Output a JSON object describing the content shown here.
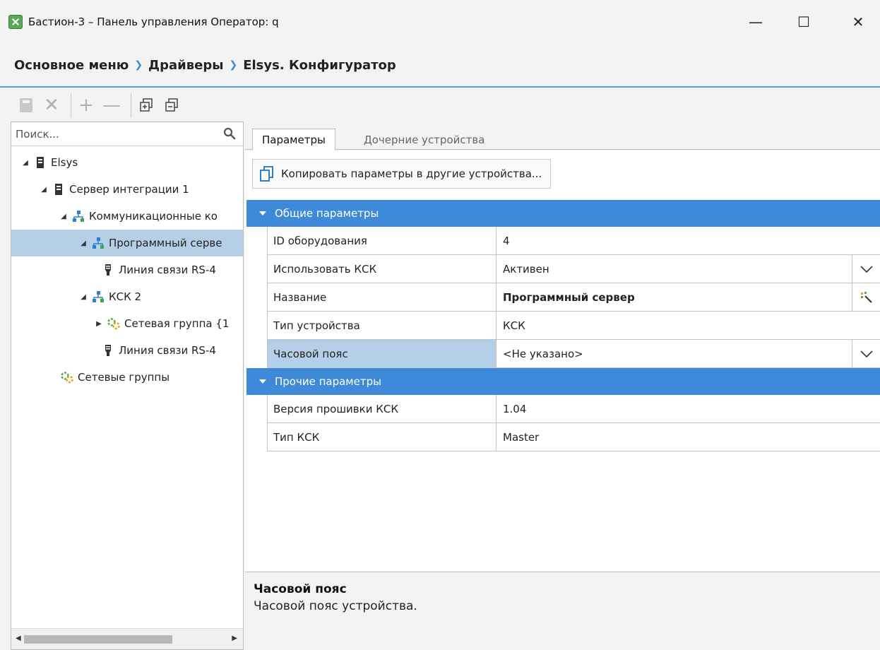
{
  "window": {
    "title": "Бастион-3 – Панель управления Оператор: q",
    "icon": "app-icon",
    "buttons": {
      "minimize": "—",
      "maximize": "☐",
      "close": "✕"
    }
  },
  "breadcrumb": {
    "items": [
      "Основное меню",
      "Драйверы",
      "Elsys. Конфигуратор"
    ],
    "separator": "❯"
  },
  "toolbar": {
    "icons": [
      "save-icon",
      "delete-icon",
      "add-icon",
      "remove-icon",
      "expand-all-icon",
      "collapse-all-icon"
    ],
    "delete_glyph": "✕",
    "add_glyph": "+",
    "remove_glyph": "—"
  },
  "search": {
    "placeholder": "Поиск..."
  },
  "tree": {
    "items": [
      {
        "label": "Elsys",
        "expander": "expanded",
        "icon": "server-icon"
      },
      {
        "label": "Сервер интеграции 1",
        "expander": "expanded",
        "icon": "server-icon"
      },
      {
        "label": "Коммуникационные ко",
        "expander": "expanded",
        "icon": "network-icon"
      },
      {
        "label": "Программный серве",
        "expander": "expanded",
        "icon": "network-icon",
        "selected": true
      },
      {
        "label": "Линия связи RS-4",
        "expander": "none",
        "icon": "line-icon"
      },
      {
        "label": "КСК 2",
        "expander": "expanded",
        "icon": "network-icon"
      },
      {
        "label": "Сетевая группа {1",
        "expander": "collapsed",
        "icon": "group-icon"
      },
      {
        "label": "Линия связи RS-4",
        "expander": "none",
        "icon": "line-icon"
      },
      {
        "label": "Сетевые группы",
        "expander": "none",
        "icon": "group-icon"
      }
    ]
  },
  "tabs": [
    {
      "label": "Параметры",
      "active": true
    },
    {
      "label": "Дочерние устройства",
      "active": false
    }
  ],
  "copy_button": {
    "label": "Копировать параметры в другие устройства..."
  },
  "groups": [
    {
      "title": "Общие параметры",
      "rows": [
        {
          "name": "ID оборудования",
          "value": "4"
        },
        {
          "name": "Использовать КСК",
          "value": "Активен",
          "control": "dropdown"
        },
        {
          "name": "Название",
          "value": "Программный сервер",
          "control": "wizard",
          "bold": true
        },
        {
          "name": "Тип устройства",
          "value": "КСК"
        },
        {
          "name": "Часовой пояс",
          "value": "<Не указано>",
          "control": "dropdown",
          "selected": true
        }
      ]
    },
    {
      "title": "Прочие параметры",
      "rows": [
        {
          "name": "Версия прошивки КСК",
          "value": "1.04"
        },
        {
          "name": "Тип КСК",
          "value": "Master"
        }
      ]
    }
  ],
  "description": {
    "title": "Часовой пояс",
    "text": "Часовой пояс устройства."
  },
  "colors": {
    "accent": "#3e8ad8",
    "selection": "#b5cfe8",
    "breadcrumb_separator": "#3b8ed8"
  }
}
